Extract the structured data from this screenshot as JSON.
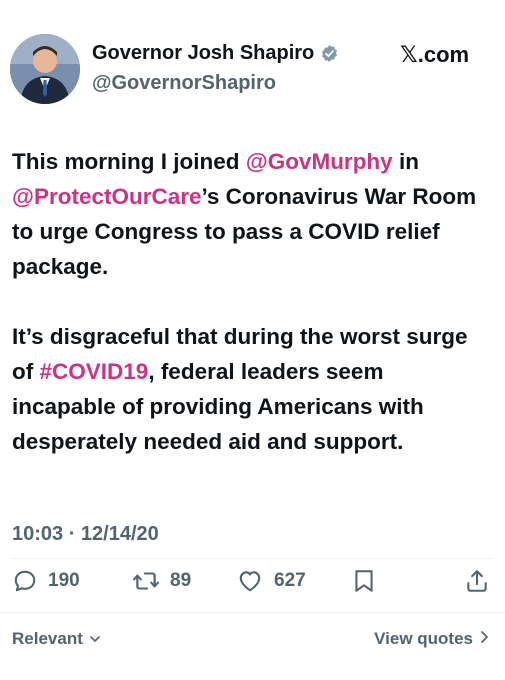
{
  "author": {
    "name": "Governor Josh Shapiro",
    "handle": "@GovernorShapiro",
    "verified_color": "#829aab"
  },
  "source_label": "𝕏.com",
  "tweet": {
    "para1": {
      "t1": "This morning I joined ",
      "m1": "@GovMurphy",
      "t2": " in ",
      "m2": "@ProtectOurCare",
      "t3": "’s Coronavirus War Room to urge Congress to pass a COVID relief package."
    },
    "para2": {
      "t1": "It’s disgraceful that during the worst surge of ",
      "h1": "#COVID19",
      "t2": ", federal leaders seem incapable of providing Americans with desperately needed aid and support."
    },
    "link_color": "#cc3380"
  },
  "timestamp": "10:03 · 12/14/20",
  "actions": {
    "replies": "190",
    "reposts": "89",
    "likes": "627",
    "reply_icon": "reply-icon",
    "repost_icon": "repost-icon",
    "like_icon": "heart-icon",
    "bookmark_icon": "bookmark-icon",
    "share_icon": "share-icon"
  },
  "footer": {
    "sort_label": "Relevant",
    "view_quotes_label": "View quotes"
  }
}
